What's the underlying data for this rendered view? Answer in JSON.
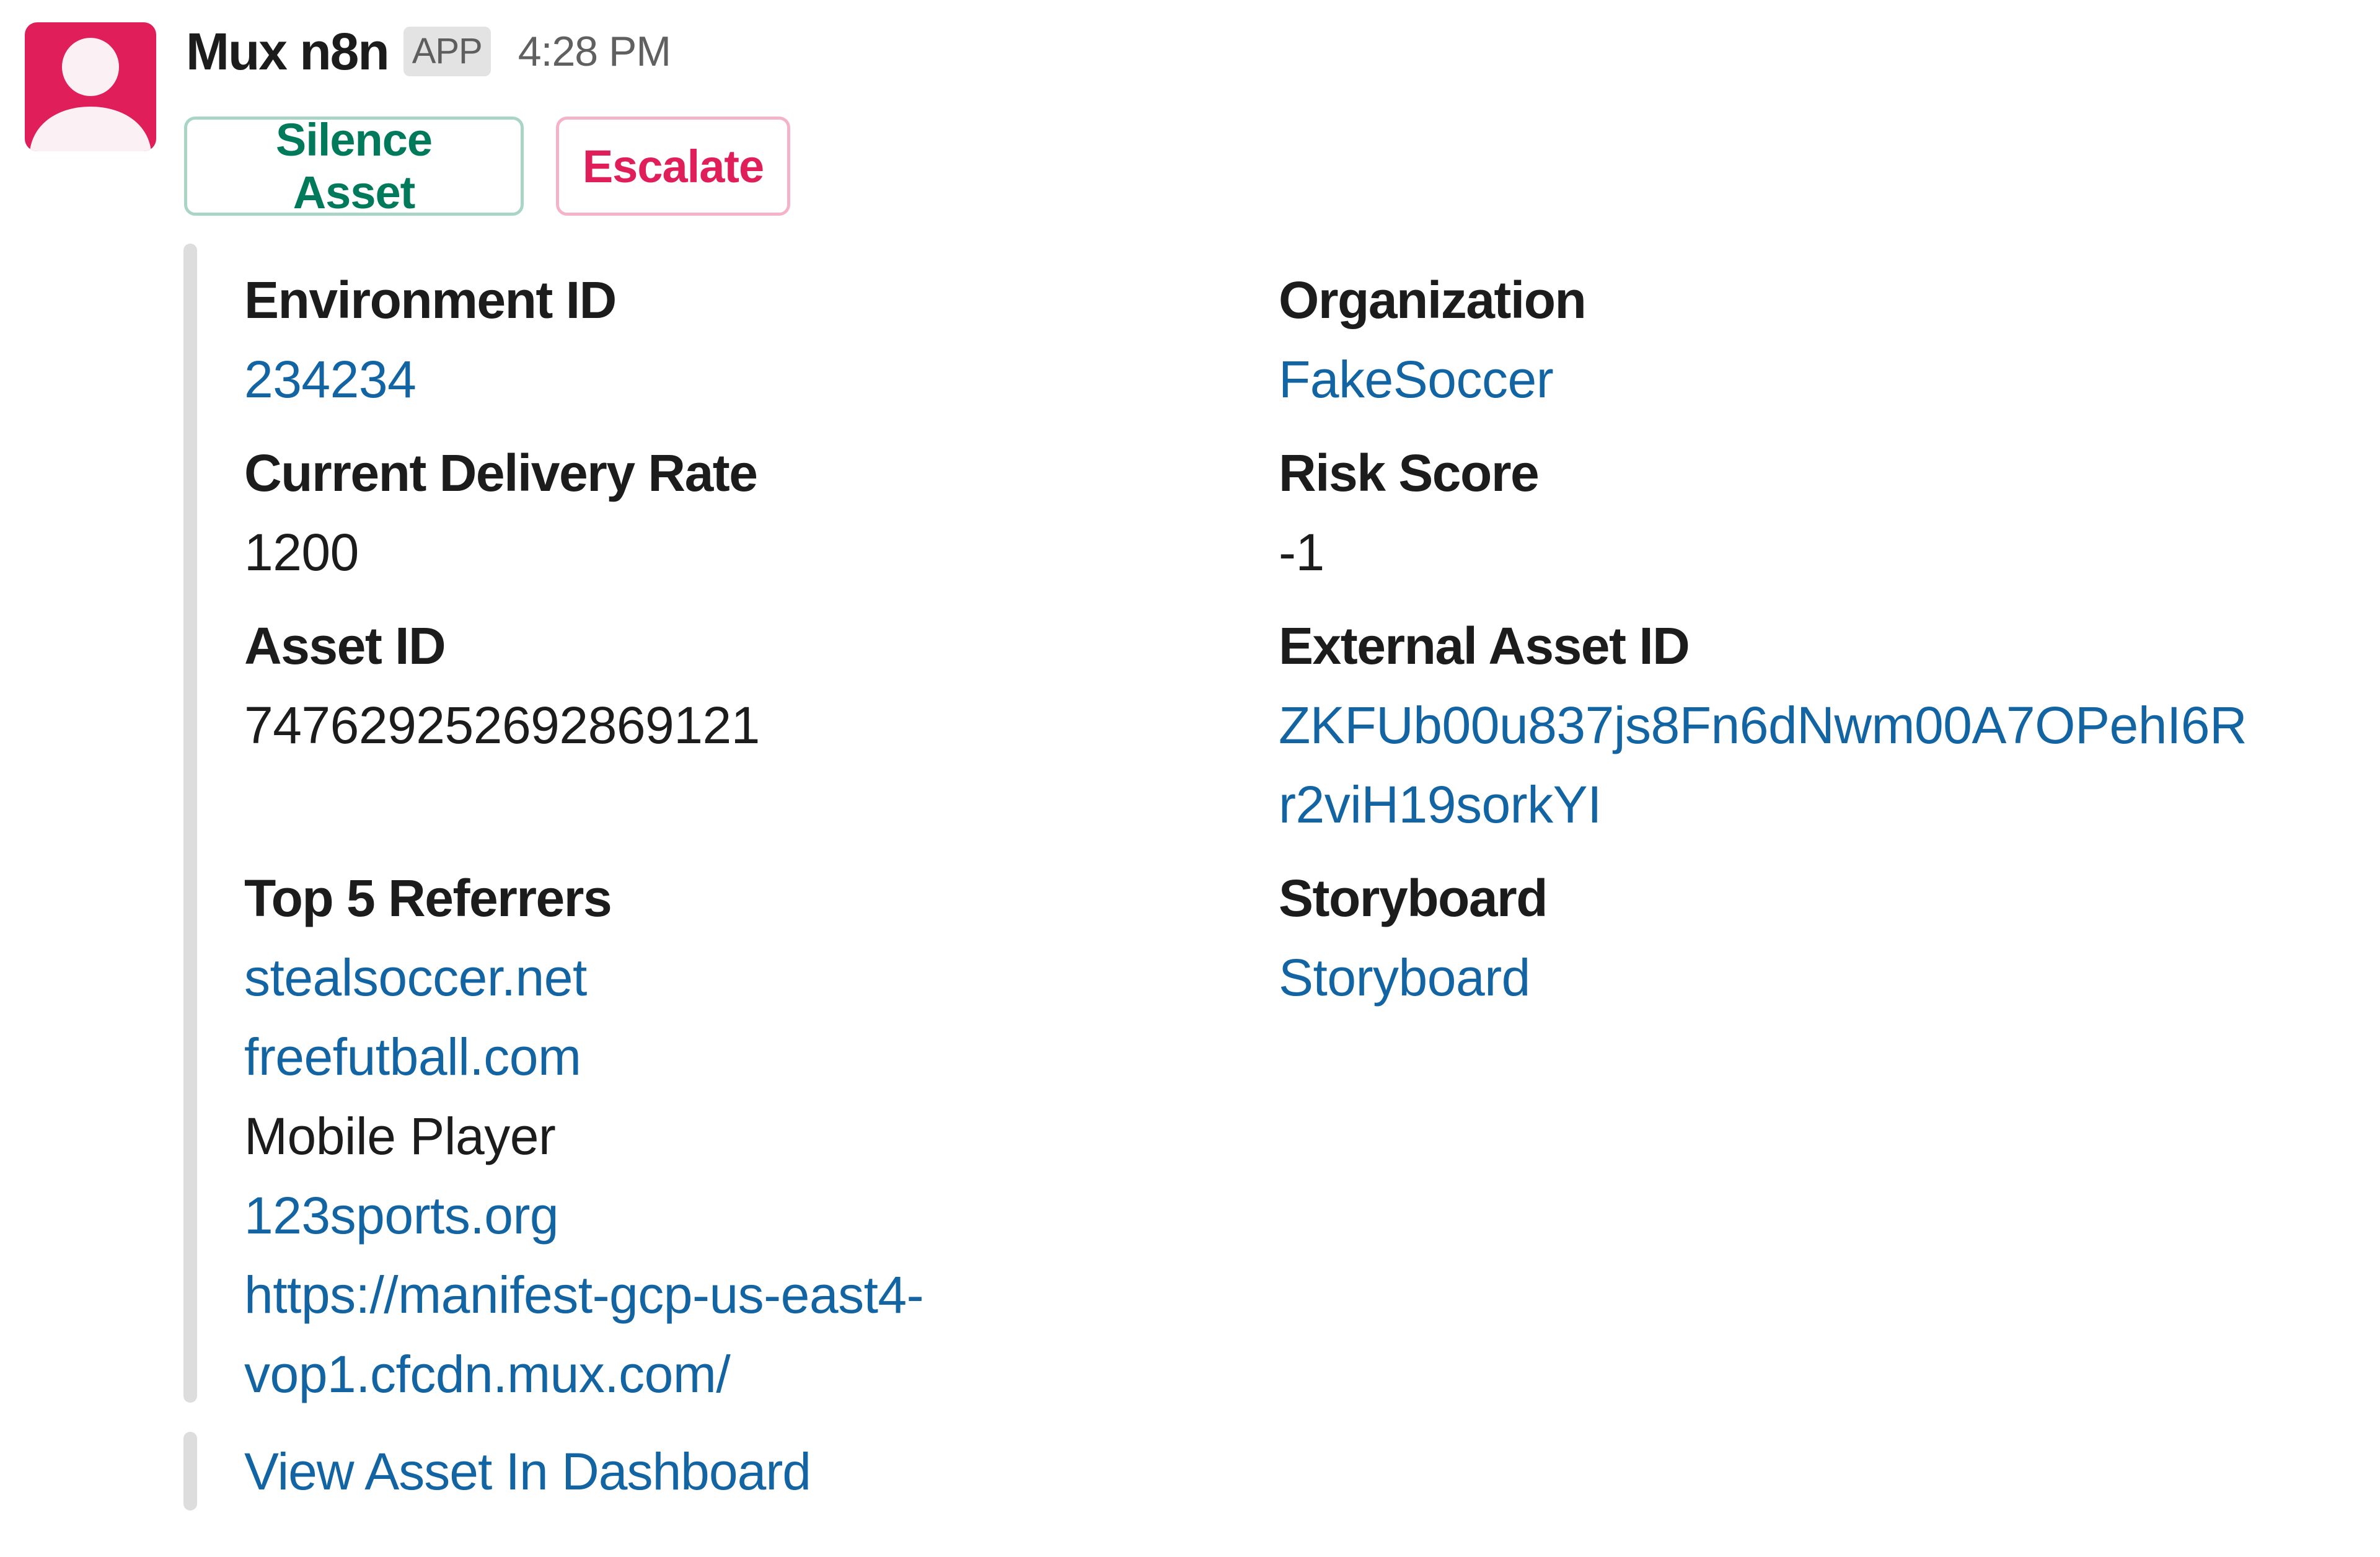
{
  "message": {
    "sender": "Mux n8n",
    "badge": "APP",
    "timestamp": "4:28 PM",
    "avatar_icon": "user-silhouette-icon",
    "avatar_color": "#E01E5A"
  },
  "actions": {
    "silence_label": "Silence Asset",
    "escalate_label": "Escalate"
  },
  "colors": {
    "link": "#1264A3",
    "primary_button_text": "#007A5A",
    "danger_button_text": "#E01E5A",
    "attachment_bar": "#DDDDDD"
  },
  "fields": {
    "environment_id": {
      "label": "Environment ID",
      "value": "234234"
    },
    "organization": {
      "label": "Organization",
      "value": "FakeSoccer"
    },
    "current_delivery_rate": {
      "label": "Current Delivery Rate",
      "value": "1200"
    },
    "risk_score": {
      "label": "Risk Score",
      "value": "-1"
    },
    "asset_id": {
      "label": "Asset ID",
      "value": "747629252692869121"
    },
    "external_asset_id": {
      "label": "External Asset ID",
      "value": "ZKFUb00u837js8Fn6dNwm00A7OPehI6Rr2viH19sorkYI"
    },
    "top_referrers": {
      "label": "Top 5 Referrers",
      "items": [
        {
          "text": "stealsoccer.net",
          "is_link": true
        },
        {
          "text": "freefutball.com",
          "is_link": true
        },
        {
          "text": "Mobile Player",
          "is_link": false
        },
        {
          "text": "123sports.org",
          "is_link": true
        },
        {
          "text": "https://manifest-gcp-us-east4-vop1.cfcdn.mux.com/",
          "is_link": true
        }
      ]
    },
    "storyboard": {
      "label": "Storyboard",
      "value": "Storyboard"
    }
  },
  "footer": {
    "dashboard_link": "View Asset In Dashboard"
  }
}
